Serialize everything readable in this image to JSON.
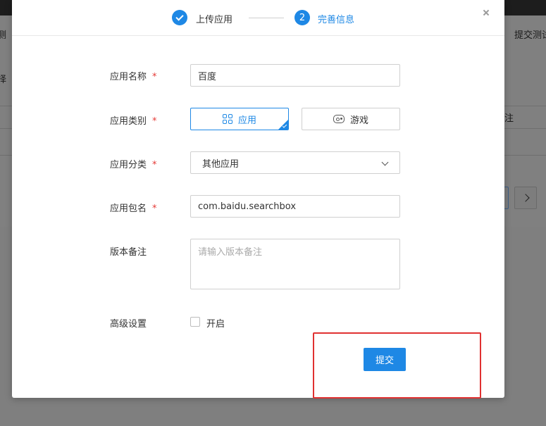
{
  "background": {
    "left_fragment_1": "测",
    "left_fragment_2": "择",
    "right_link": "提交测试",
    "right_column": "注"
  },
  "steps": [
    {
      "label": "上传应用",
      "status": "done"
    },
    {
      "number": "2",
      "label": "完善信息",
      "status": "active"
    }
  ],
  "form": {
    "app_name": {
      "label": "应用名称",
      "required": "*",
      "value": "百度"
    },
    "app_type": {
      "label": "应用类别",
      "required": "*",
      "options": [
        "应用",
        "游戏"
      ],
      "selected": "应用"
    },
    "app_category": {
      "label": "应用分类",
      "required": "*",
      "value": "其他应用"
    },
    "package_name": {
      "label": "应用包名",
      "required": "*",
      "value": "com.baidu.searchbox"
    },
    "version_note": {
      "label": "版本备注",
      "placeholder": "请输入版本备注"
    },
    "advanced": {
      "label": "高级设置",
      "checkbox_label": "开启",
      "checked": false
    }
  },
  "submit_label": "提交",
  "colors": {
    "primary": "#1e88e5",
    "highlight": "#e03131",
    "required": "#e53935"
  },
  "icons": [
    "check-icon",
    "close-icon",
    "grid-icon",
    "gamepad-icon",
    "chevron-down-icon",
    "chevron-right-icon"
  ]
}
